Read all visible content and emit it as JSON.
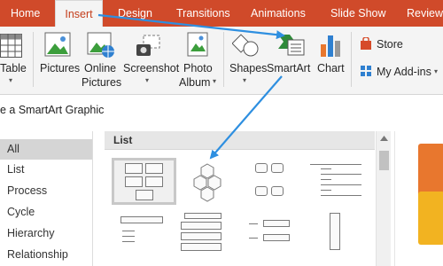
{
  "ribbon_tabs": [
    "Home",
    "Insert",
    "Design",
    "Transitions",
    "Animations",
    "Slide Show",
    "Review"
  ],
  "active_tab": "Insert",
  "ribbon": {
    "table": "Table",
    "pictures": "Pictures",
    "online_pictures_1": "Online",
    "online_pictures_2": "Pictures",
    "screenshot": "Screenshot",
    "photo_album_1": "Photo",
    "photo_album_2": "Album",
    "shapes": "Shapes",
    "smartart": "SmartArt",
    "chart": "Chart",
    "store": "Store",
    "my_addins": "My Add-ins"
  },
  "dialog": {
    "title": "e a SmartArt Graphic",
    "categories": [
      "All",
      "List",
      "Process",
      "Cycle",
      "Hierarchy",
      "Relationship"
    ],
    "selected_category": "All",
    "section_header": "List"
  },
  "colors": {
    "tab_bar": "#d04a2a",
    "active_tab_text": "#c43e1c",
    "arrow": "#2e8fe0",
    "preview_orange": "#e8772e",
    "preview_yellow": "#f2b321"
  },
  "icons": [
    "table-icon",
    "pictures-icon",
    "online-pictures-icon",
    "screenshot-icon",
    "photo-album-icon",
    "shapes-icon",
    "smartart-icon",
    "chart-icon",
    "store-icon",
    "my-addins-icon"
  ]
}
